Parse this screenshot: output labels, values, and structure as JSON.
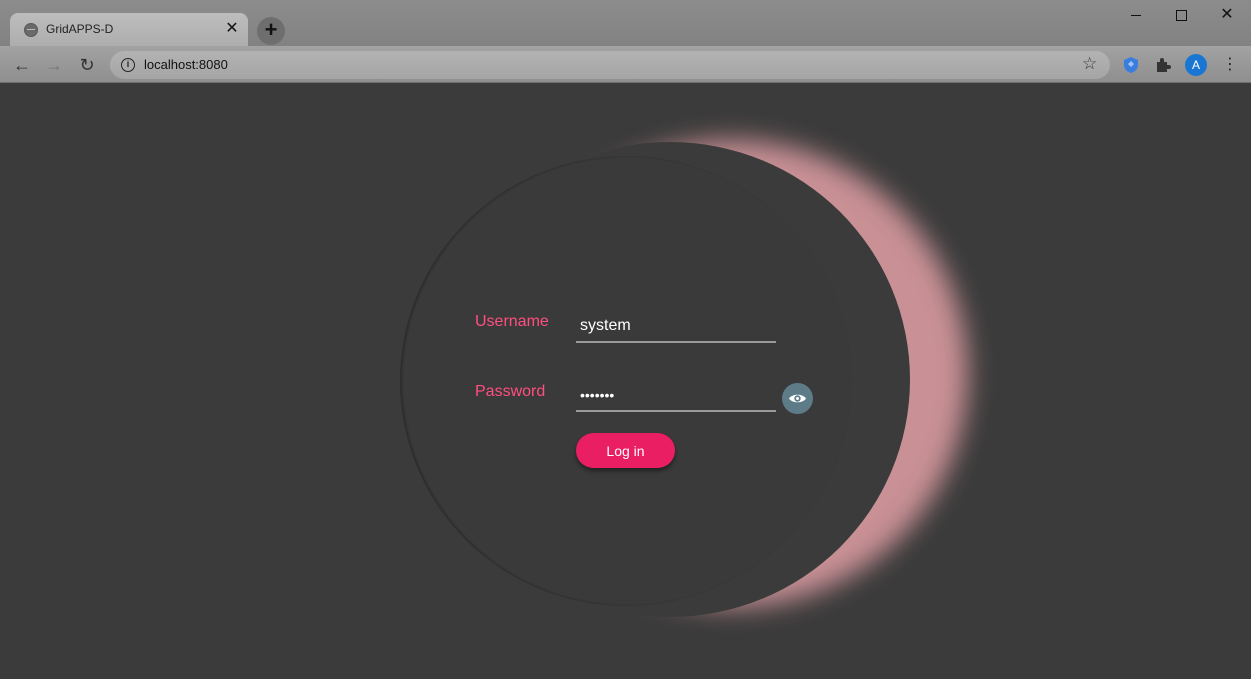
{
  "browser": {
    "tab_title": "GridAPPS-D",
    "tab_close": "✕",
    "new_tab": "+",
    "url": "localhost:8080",
    "avatar_letter": "A"
  },
  "login": {
    "username_label": "Username",
    "username_value": "system",
    "password_label": "Password",
    "password_masked": "•••••••",
    "login_button": "Log in"
  },
  "colors": {
    "accent": "#e91e63",
    "label": "#ff4f80",
    "glow": "#c99196",
    "background": "#3b3b3b",
    "eye_button": "#5e7c88"
  }
}
